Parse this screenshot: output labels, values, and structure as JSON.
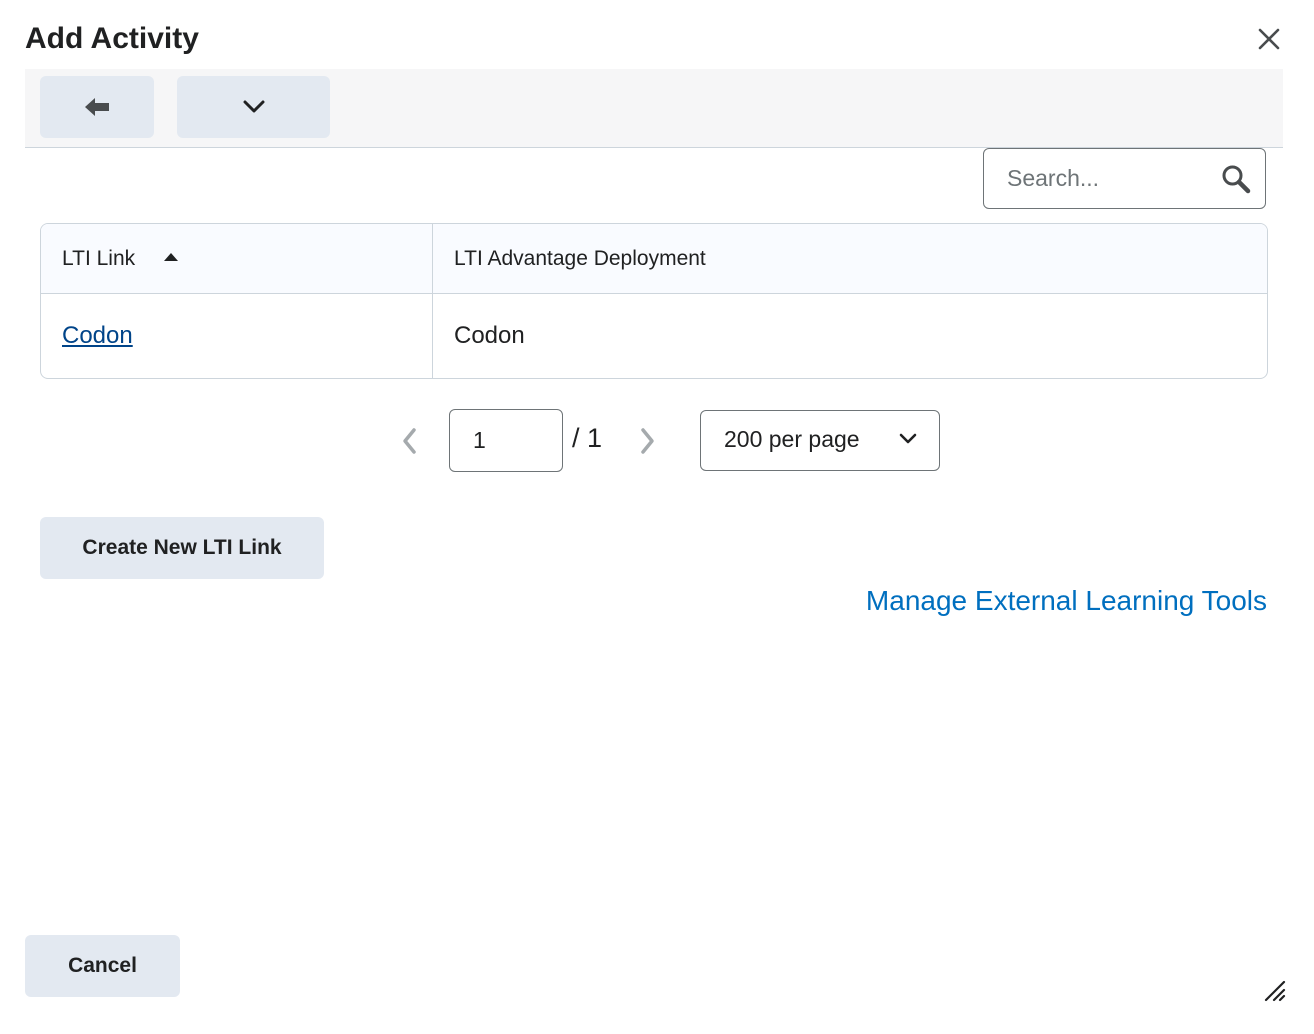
{
  "dialog": {
    "title": "Add Activity",
    "close_icon": "close-icon"
  },
  "toolbar": {
    "back_icon": "arrow-left-icon",
    "menu_icon": "chevron-down-icon"
  },
  "search": {
    "placeholder": "Search...",
    "value": "",
    "icon": "search-icon"
  },
  "table": {
    "columns": [
      {
        "label": "LTI Link",
        "sort": "ascending"
      },
      {
        "label": "LTI Advantage Deployment"
      }
    ],
    "rows": [
      {
        "lti_link": "Codon",
        "deployment": "Codon"
      }
    ]
  },
  "pager": {
    "current_page": "1",
    "total_label": "/ 1",
    "page_size_label": "200 per page"
  },
  "actions": {
    "create_label": "Create New LTI Link",
    "manage_link_label": "Manage External Learning Tools",
    "cancel_label": "Cancel"
  },
  "colors": {
    "link": "#006fbf",
    "button_bg": "#e3e9f1",
    "border": "#cdd5dc"
  }
}
